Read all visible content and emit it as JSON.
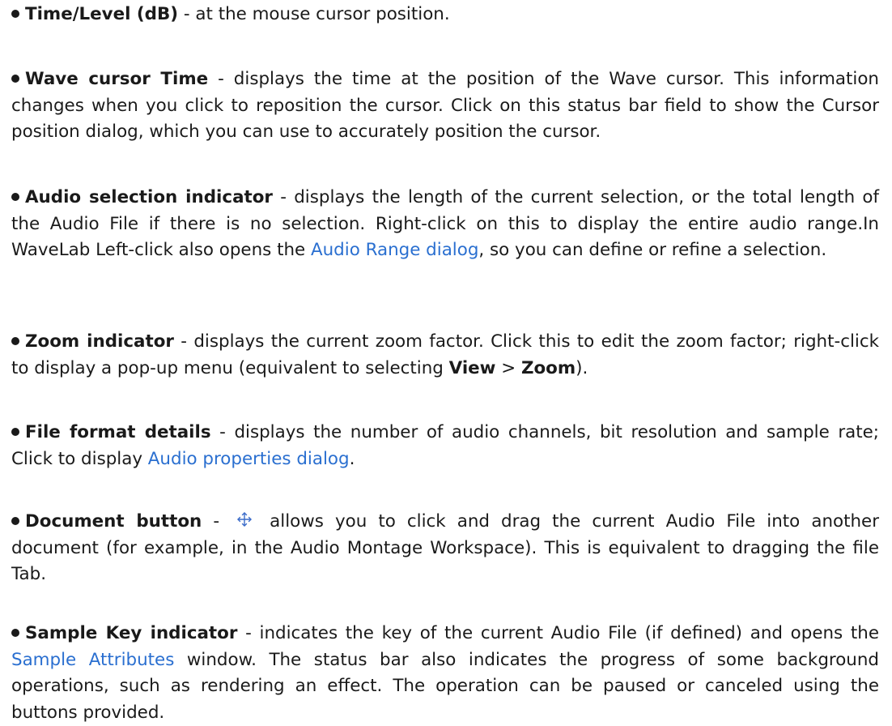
{
  "items": [
    {
      "term": "Time/Level (dB)",
      "text": " - at the mouse cursor position."
    },
    {
      "term": "Wave cursor Time",
      "text": " - displays the time at the position of the Wave cursor. This information changes when you click to reposition the cursor. Click on this status bar field to show the Cursor position dialog, which you can use to accurately position the cursor."
    },
    {
      "term": "Audio selection indicator",
      "text_before": " - displays the length of the current selection, or the total length of the Audio File if there is no selection. Right-click on this to display the entire audio range.In WaveLab Left-click also opens the ",
      "link": "Audio Range dialog",
      "text_after": ", so you can define or refine a selection."
    },
    {
      "term": "Zoom indicator",
      "text_before": " - displays the current zoom factor. Click this to edit the zoom factor; right-click to display a pop-up menu (equivalent to selecting ",
      "menu_a": "View",
      "separator": " > ",
      "menu_b": "Zoom",
      "text_after": ")."
    },
    {
      "term": "File format details",
      "text_before": " - displays the number of audio channels, bit resolution and sample rate; Click to display ",
      "link": "Audio properties dialog",
      "text_after": "."
    },
    {
      "term": "Document button",
      "text_before": " - ",
      "icon": "move-arrows-icon",
      "text_after": " allows you to click and drag the current Audio File into another document (for example, in the Audio Montage Workspace). This is equivalent to dragging the file Tab."
    },
    {
      "term": "Sample Key indicator",
      "text_before": " - indicates the key of the current Audio File (if defined) and opens the ",
      "link": "Sample Attributes",
      "text_after": " window.  The status bar also indicates the progress of some background operations, such as rendering an effect.  The operation can be paused or canceled using the buttons provided."
    }
  ],
  "colors": {
    "text": "#1a1a1a",
    "link": "#2a6fd0",
    "icon": "#3a6bc9"
  }
}
